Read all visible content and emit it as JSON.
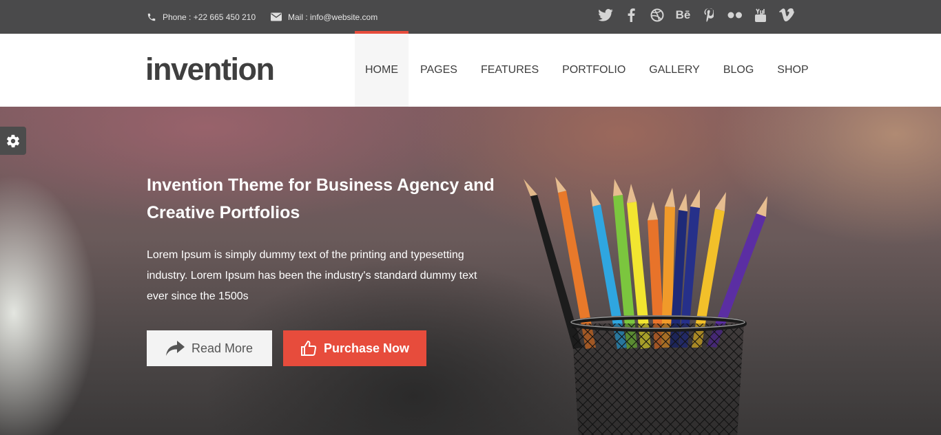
{
  "topbar": {
    "phone": "Phone : +22 665 450 210",
    "mail": "Mail : info@website.com",
    "social": [
      "twitter-icon",
      "facebook-icon",
      "dribbble-icon",
      "behance-icon",
      "pinterest-icon",
      "flickr-icon",
      "youtube-icon",
      "vimeo-icon"
    ]
  },
  "header": {
    "logo": "invention",
    "nav": [
      "HOME",
      "PAGES",
      "FEATURES",
      "PORTFOLIO",
      "GALLERY",
      "BLOG",
      "SHOP"
    ]
  },
  "hero": {
    "title": "Invention Theme for Business Agency and Creative Portfolios",
    "text": "Lorem Ipsum is simply dummy text of the printing and typesetting industry. Lorem Ipsum has been the industry's standard dummy text ever since the 1500s",
    "read_more": "Read More",
    "purchase": "Purchase Now"
  },
  "colors": {
    "accent": "#e74c3c",
    "topbar": "#4a4a4b"
  }
}
